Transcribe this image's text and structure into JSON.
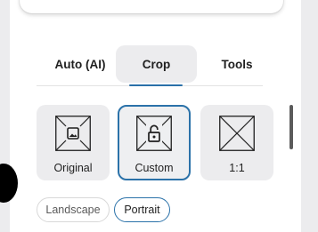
{
  "tabs": [
    {
      "label": "Auto (AI)",
      "selected": false
    },
    {
      "label": "Crop",
      "selected": true
    },
    {
      "label": "Tools",
      "selected": false
    }
  ],
  "aspect_ratios": [
    {
      "label": "Original",
      "icon": "image-icon",
      "selected": false
    },
    {
      "label": "Custom",
      "icon": "unlock-icon",
      "selected": true
    },
    {
      "label": "1:1",
      "icon": "square-crossed-icon",
      "selected": false
    }
  ],
  "orientation": {
    "options": [
      {
        "label": "Landscape",
        "selected": false
      },
      {
        "label": "Portrait",
        "selected": true
      }
    ]
  },
  "colors": {
    "accent": "#2b72a9",
    "selected_tab_bg": "#ececee",
    "card_bg": "#ececee",
    "text": "#1f1f1f"
  }
}
